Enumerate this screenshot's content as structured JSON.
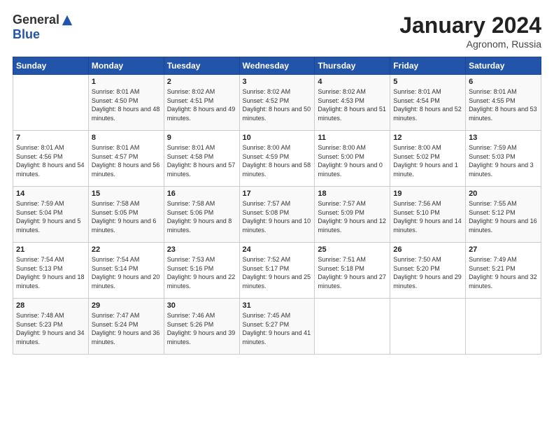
{
  "header": {
    "logo_general": "General",
    "logo_blue": "Blue",
    "month_title": "January 2024",
    "subtitle": "Agronom, Russia"
  },
  "days_of_week": [
    "Sunday",
    "Monday",
    "Tuesday",
    "Wednesday",
    "Thursday",
    "Friday",
    "Saturday"
  ],
  "weeks": [
    [
      {
        "day": "",
        "sunrise": "",
        "sunset": "",
        "daylight": ""
      },
      {
        "day": "1",
        "sunrise": "Sunrise: 8:01 AM",
        "sunset": "Sunset: 4:50 PM",
        "daylight": "Daylight: 8 hours and 48 minutes."
      },
      {
        "day": "2",
        "sunrise": "Sunrise: 8:02 AM",
        "sunset": "Sunset: 4:51 PM",
        "daylight": "Daylight: 8 hours and 49 minutes."
      },
      {
        "day": "3",
        "sunrise": "Sunrise: 8:02 AM",
        "sunset": "Sunset: 4:52 PM",
        "daylight": "Daylight: 8 hours and 50 minutes."
      },
      {
        "day": "4",
        "sunrise": "Sunrise: 8:02 AM",
        "sunset": "Sunset: 4:53 PM",
        "daylight": "Daylight: 8 hours and 51 minutes."
      },
      {
        "day": "5",
        "sunrise": "Sunrise: 8:01 AM",
        "sunset": "Sunset: 4:54 PM",
        "daylight": "Daylight: 8 hours and 52 minutes."
      },
      {
        "day": "6",
        "sunrise": "Sunrise: 8:01 AM",
        "sunset": "Sunset: 4:55 PM",
        "daylight": "Daylight: 8 hours and 53 minutes."
      }
    ],
    [
      {
        "day": "7",
        "sunrise": "Sunrise: 8:01 AM",
        "sunset": "Sunset: 4:56 PM",
        "daylight": "Daylight: 8 hours and 54 minutes."
      },
      {
        "day": "8",
        "sunrise": "Sunrise: 8:01 AM",
        "sunset": "Sunset: 4:57 PM",
        "daylight": "Daylight: 8 hours and 56 minutes."
      },
      {
        "day": "9",
        "sunrise": "Sunrise: 8:01 AM",
        "sunset": "Sunset: 4:58 PM",
        "daylight": "Daylight: 8 hours and 57 minutes."
      },
      {
        "day": "10",
        "sunrise": "Sunrise: 8:00 AM",
        "sunset": "Sunset: 4:59 PM",
        "daylight": "Daylight: 8 hours and 58 minutes."
      },
      {
        "day": "11",
        "sunrise": "Sunrise: 8:00 AM",
        "sunset": "Sunset: 5:00 PM",
        "daylight": "Daylight: 9 hours and 0 minutes."
      },
      {
        "day": "12",
        "sunrise": "Sunrise: 8:00 AM",
        "sunset": "Sunset: 5:02 PM",
        "daylight": "Daylight: 9 hours and 1 minute."
      },
      {
        "day": "13",
        "sunrise": "Sunrise: 7:59 AM",
        "sunset": "Sunset: 5:03 PM",
        "daylight": "Daylight: 9 hours and 3 minutes."
      }
    ],
    [
      {
        "day": "14",
        "sunrise": "Sunrise: 7:59 AM",
        "sunset": "Sunset: 5:04 PM",
        "daylight": "Daylight: 9 hours and 5 minutes."
      },
      {
        "day": "15",
        "sunrise": "Sunrise: 7:58 AM",
        "sunset": "Sunset: 5:05 PM",
        "daylight": "Daylight: 9 hours and 6 minutes."
      },
      {
        "day": "16",
        "sunrise": "Sunrise: 7:58 AM",
        "sunset": "Sunset: 5:06 PM",
        "daylight": "Daylight: 9 hours and 8 minutes."
      },
      {
        "day": "17",
        "sunrise": "Sunrise: 7:57 AM",
        "sunset": "Sunset: 5:08 PM",
        "daylight": "Daylight: 9 hours and 10 minutes."
      },
      {
        "day": "18",
        "sunrise": "Sunrise: 7:57 AM",
        "sunset": "Sunset: 5:09 PM",
        "daylight": "Daylight: 9 hours and 12 minutes."
      },
      {
        "day": "19",
        "sunrise": "Sunrise: 7:56 AM",
        "sunset": "Sunset: 5:10 PM",
        "daylight": "Daylight: 9 hours and 14 minutes."
      },
      {
        "day": "20",
        "sunrise": "Sunrise: 7:55 AM",
        "sunset": "Sunset: 5:12 PM",
        "daylight": "Daylight: 9 hours and 16 minutes."
      }
    ],
    [
      {
        "day": "21",
        "sunrise": "Sunrise: 7:54 AM",
        "sunset": "Sunset: 5:13 PM",
        "daylight": "Daylight: 9 hours and 18 minutes."
      },
      {
        "day": "22",
        "sunrise": "Sunrise: 7:54 AM",
        "sunset": "Sunset: 5:14 PM",
        "daylight": "Daylight: 9 hours and 20 minutes."
      },
      {
        "day": "23",
        "sunrise": "Sunrise: 7:53 AM",
        "sunset": "Sunset: 5:16 PM",
        "daylight": "Daylight: 9 hours and 22 minutes."
      },
      {
        "day": "24",
        "sunrise": "Sunrise: 7:52 AM",
        "sunset": "Sunset: 5:17 PM",
        "daylight": "Daylight: 9 hours and 25 minutes."
      },
      {
        "day": "25",
        "sunrise": "Sunrise: 7:51 AM",
        "sunset": "Sunset: 5:18 PM",
        "daylight": "Daylight: 9 hours and 27 minutes."
      },
      {
        "day": "26",
        "sunrise": "Sunrise: 7:50 AM",
        "sunset": "Sunset: 5:20 PM",
        "daylight": "Daylight: 9 hours and 29 minutes."
      },
      {
        "day": "27",
        "sunrise": "Sunrise: 7:49 AM",
        "sunset": "Sunset: 5:21 PM",
        "daylight": "Daylight: 9 hours and 32 minutes."
      }
    ],
    [
      {
        "day": "28",
        "sunrise": "Sunrise: 7:48 AM",
        "sunset": "Sunset: 5:23 PM",
        "daylight": "Daylight: 9 hours and 34 minutes."
      },
      {
        "day": "29",
        "sunrise": "Sunrise: 7:47 AM",
        "sunset": "Sunset: 5:24 PM",
        "daylight": "Daylight: 9 hours and 36 minutes."
      },
      {
        "day": "30",
        "sunrise": "Sunrise: 7:46 AM",
        "sunset": "Sunset: 5:26 PM",
        "daylight": "Daylight: 9 hours and 39 minutes."
      },
      {
        "day": "31",
        "sunrise": "Sunrise: 7:45 AM",
        "sunset": "Sunset: 5:27 PM",
        "daylight": "Daylight: 9 hours and 41 minutes."
      },
      {
        "day": "",
        "sunrise": "",
        "sunset": "",
        "daylight": ""
      },
      {
        "day": "",
        "sunrise": "",
        "sunset": "",
        "daylight": ""
      },
      {
        "day": "",
        "sunrise": "",
        "sunset": "",
        "daylight": ""
      }
    ]
  ]
}
